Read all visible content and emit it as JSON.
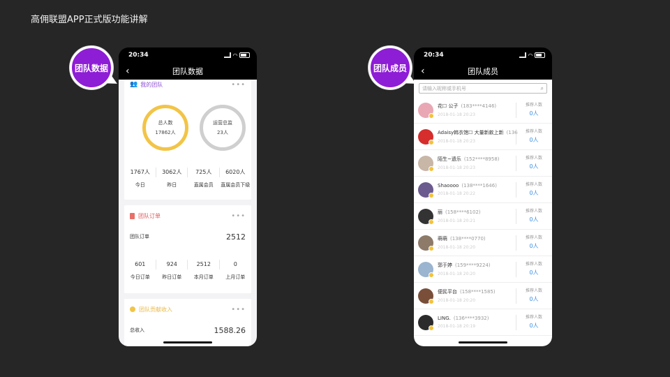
{
  "slide_title": "高佣联盟APP正式版功能讲解",
  "badges": {
    "left": "团队数据",
    "right": "团队成员"
  },
  "status_bar": {
    "time": "20:34"
  },
  "left_phone": {
    "nav_title": "团队数据",
    "my_team": {
      "title": "我的团队",
      "total_label": "总人数",
      "total_value": "17862人",
      "ops_label": "运营总监",
      "ops_value": "23人",
      "stats": [
        {
          "value": "1767人",
          "label": "今日"
        },
        {
          "value": "3062人",
          "label": "昨日"
        },
        {
          "value": "725人",
          "label": "直属会员"
        },
        {
          "value": "6020人",
          "label": "直属会员下级"
        }
      ]
    },
    "team_orders": {
      "title": "团队订单",
      "summary_label": "团队订单",
      "summary_value": "2512",
      "stats": [
        {
          "value": "601",
          "label": "今日订单"
        },
        {
          "value": "924",
          "label": "昨日订单"
        },
        {
          "value": "2512",
          "label": "本月订单"
        },
        {
          "value": "0",
          "label": "上月订单"
        }
      ]
    },
    "team_income": {
      "title": "团队贡献收入",
      "summary_label": "总收入",
      "summary_value": "1588.26"
    }
  },
  "right_phone": {
    "nav_title": "团队成员",
    "search_placeholder": "请输入昵称或手机号",
    "members": [
      {
        "name": "花☐ 公子",
        "phone": "(183****4146)",
        "date": "2018-01-18 20:23",
        "ref_label": "推荐人数",
        "ref_value": "0人",
        "color": "#e9a7b4"
      },
      {
        "name": "Adaisy韩衣馆☐ 大量新款上新",
        "phone": "(136",
        "date": "2018-01-18 20:23",
        "ref_label": "推荐人数",
        "ref_value": "0人",
        "color": "#d62d2d"
      },
      {
        "name": "陌生~遗乐",
        "phone": "(152****8958)",
        "date": "2018-01-18 20:23",
        "ref_label": "推荐人数",
        "ref_value": "0人",
        "color": "#c8b6a6"
      },
      {
        "name": "Shaoooo",
        "phone": "(138****1646)",
        "date": "2018-01-18 20:22",
        "ref_label": "推荐人数",
        "ref_value": "0人",
        "color": "#6b5a8e"
      },
      {
        "name": "丽",
        "phone": "(158****6102)",
        "date": "2018-01-18 20:21",
        "ref_label": "推荐人数",
        "ref_value": "0人",
        "color": "#333333"
      },
      {
        "name": "萌萌",
        "phone": "(138****0770)",
        "date": "2018-01-18 20:20",
        "ref_label": "推荐人数",
        "ref_value": "0人",
        "color": "#8d7a68"
      },
      {
        "name": "郭于婷",
        "phone": "(159****9224)",
        "date": "2018-01-18 20:20",
        "ref_label": "推荐人数",
        "ref_value": "0人",
        "color": "#9bb4cf"
      },
      {
        "name": "便民平台",
        "phone": "(158****1585)",
        "date": "2018-01-18 20:20",
        "ref_label": "推荐人数",
        "ref_value": "0人",
        "color": "#7a4f3a"
      },
      {
        "name": "LING.",
        "phone": "(136****3932)",
        "date": "2018-01-18 20:19",
        "ref_label": "推荐人数",
        "ref_value": "0人",
        "color": "#2b2b2b"
      }
    ]
  }
}
